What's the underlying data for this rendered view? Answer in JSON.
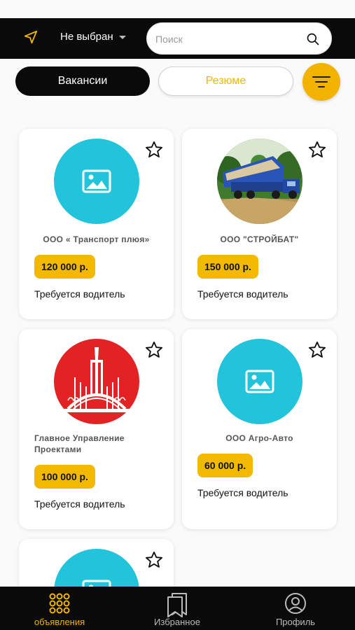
{
  "colors": {
    "accent": "#f2b300",
    "dark": "#0a0a0a",
    "placeholder_logo": "#22c4dc",
    "crest_red": "#e32323"
  },
  "header": {
    "location_icon": "location-arrow-icon",
    "city": "Не выбран",
    "search_placeholder": "Поиск",
    "search_icon": "search-icon"
  },
  "segments": {
    "vacancies": "Вакансии",
    "resumes": "Резюме",
    "filter_icon": "filter-icon"
  },
  "cards": [
    {
      "company": "ООО « Транспорт плюя»",
      "salary": "120 000 р.",
      "title": "Требуется водитель",
      "logo": "image-placeholder-icon"
    },
    {
      "company": "ООО \"СТРОЙБАТ\"",
      "salary": "150 000 р.",
      "title": "Требуется водитель",
      "logo": "dump-truck-photo"
    },
    {
      "company": "Главное Управление Проектами",
      "salary": "100 000 р.",
      "title": "Требуется водитель",
      "logo": "red-crest-logo"
    },
    {
      "company": "ООО Агро-Авто",
      "salary": "60 000 р.",
      "title": "Требуется водитель",
      "logo": "image-placeholder-icon"
    },
    {
      "company": "",
      "salary": "",
      "title": "",
      "logo": "image-placeholder-icon"
    }
  ],
  "tabs": [
    {
      "label": "объявления",
      "icon": "grid-dots-icon",
      "active": true
    },
    {
      "label": "Избранное",
      "icon": "bookmarks-icon",
      "active": false
    },
    {
      "label": "Профиль",
      "icon": "user-circle-icon",
      "active": false
    }
  ]
}
